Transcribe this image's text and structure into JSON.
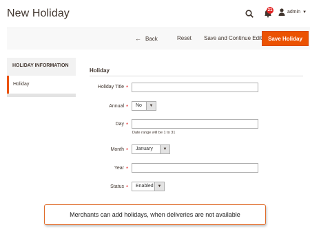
{
  "header": {
    "title": "New Holiday",
    "notification_count": "21",
    "user_name": "admin"
  },
  "toolbar": {
    "back_label": "Back",
    "reset_label": "Reset",
    "save_continue_label": "Save and Continue Edit",
    "save_label": "Save Holiday"
  },
  "sidebar": {
    "heading": "HOLIDAY INFORMATION",
    "items": [
      {
        "label": "Holiday"
      }
    ]
  },
  "form": {
    "section_title": "Holiday",
    "holiday_title": {
      "label": "Holiday Title",
      "value": ""
    },
    "annual": {
      "label": "Annual",
      "value": "No"
    },
    "day": {
      "label": "Day",
      "value": "",
      "note": "Date range will be 1 to 31"
    },
    "month": {
      "label": "Month",
      "value": "January"
    },
    "year": {
      "label": "Year",
      "value": ""
    },
    "status": {
      "label": "Status",
      "value": "Enabled"
    },
    "required_marker": "*"
  },
  "callout": {
    "text": "Merchants can add holidays, when deliveries are not available"
  },
  "colors": {
    "accent": "#eb5202",
    "required": "#e22626",
    "callout_border": "#e06a28"
  }
}
